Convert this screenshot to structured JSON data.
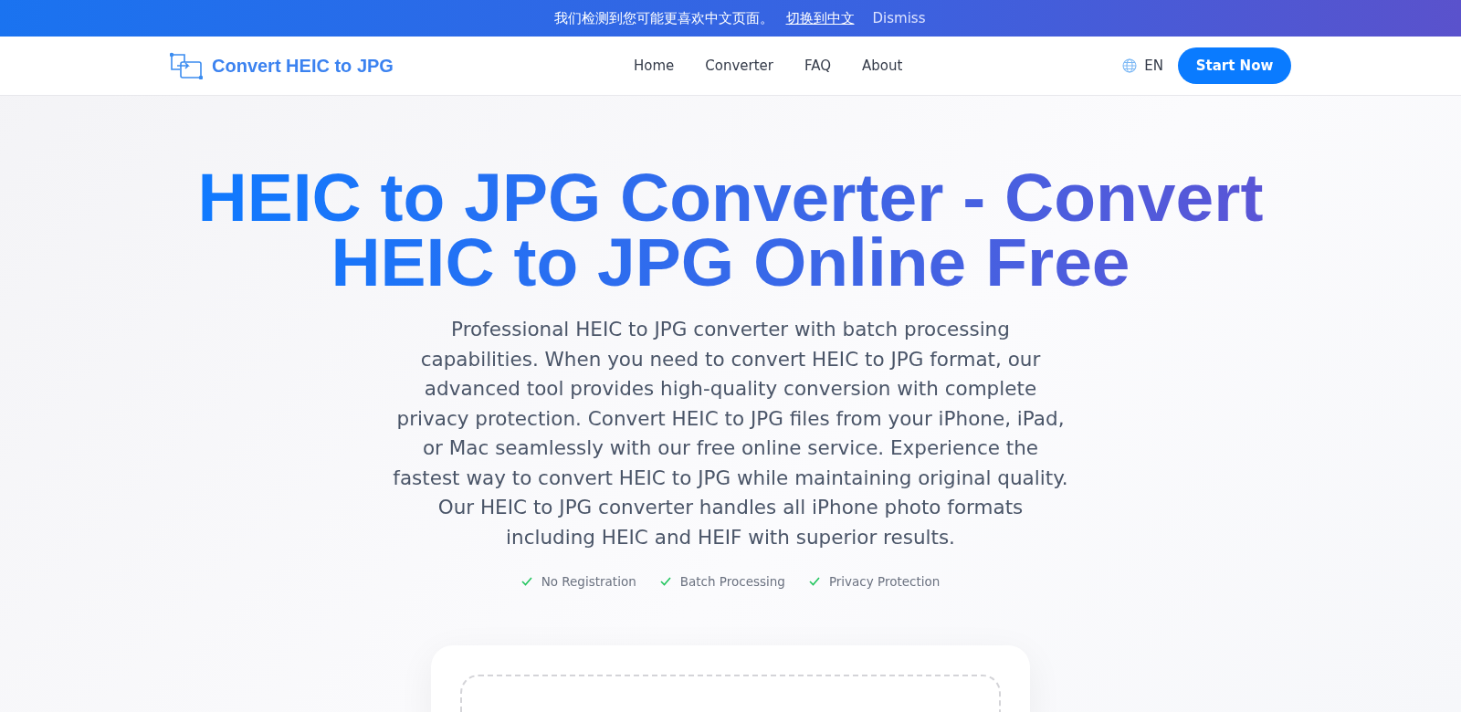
{
  "banner": {
    "message": "我们检测到您可能更喜欢中文页面。",
    "switch_link": "切换到中文",
    "dismiss": "Dismiss"
  },
  "header": {
    "logo": "Convert HEIC to JPG",
    "nav": [
      "Home",
      "Converter",
      "FAQ",
      "About"
    ],
    "language": "EN",
    "cta": "Start Now"
  },
  "hero": {
    "title": "HEIC to JPG Converter - Convert HEIC to JPG Online Free",
    "description": "Professional HEIC to JPG converter with batch processing capabilities. When you need to convert HEIC to JPG format, our advanced tool provides high-quality conversion with complete privacy protection. Convert HEIC to JPG files from your iPhone, iPad, or Mac seamlessly with our free online service. Experience the fastest way to convert HEIC to JPG while maintaining original quality. Our HEIC to JPG converter handles all iPhone photo formats including HEIC and HEIF with superior results.",
    "features": [
      "No Registration",
      "Batch Processing",
      "Privacy Protection"
    ]
  }
}
